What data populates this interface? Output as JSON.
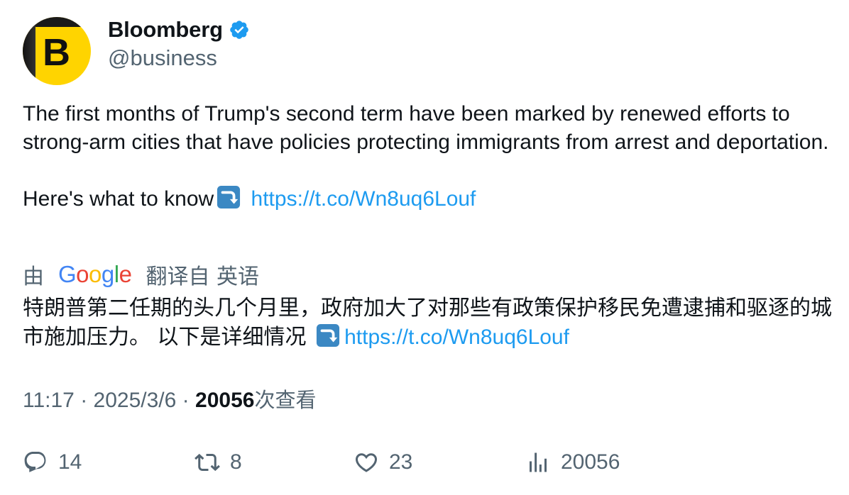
{
  "author": {
    "display_name": "Bloomberg",
    "handle": "@business",
    "verified": true,
    "avatar_letter": "B"
  },
  "tweet": {
    "text_line1": "The first months of Trump's second term have been marked by renewed efforts to strong-arm cities that have policies protecting immigrants from arrest and deportation.",
    "text_line2_prefix": "Here's what to know",
    "emoji": "arrow-right-hook-icon",
    "link": "https://t.co/Wn8uq6Louf"
  },
  "translation": {
    "prefix": "由",
    "provider": "Google",
    "suffix": "翻译自 英语",
    "text": "特朗普第二任期的头几个月里，政府加大了对那些有政策保护移民免遭逮捕和驱逐的城市施加压力。 以下是详细情况",
    "link": "https://t.co/Wn8uq6Louf"
  },
  "meta": {
    "time": "11:17",
    "sep1": "·",
    "date": "2025/3/6",
    "sep2": "·",
    "views_count": "20056",
    "views_label": "次查看"
  },
  "actions": {
    "replies": "14",
    "retweets": "8",
    "likes": "23",
    "views": "20056"
  },
  "colors": {
    "link": "#1d9bf0",
    "secondary_text": "#536471",
    "primary_text": "#0f1419",
    "avatar_bg": "#ffd400",
    "verified": "#1d9bf0"
  }
}
